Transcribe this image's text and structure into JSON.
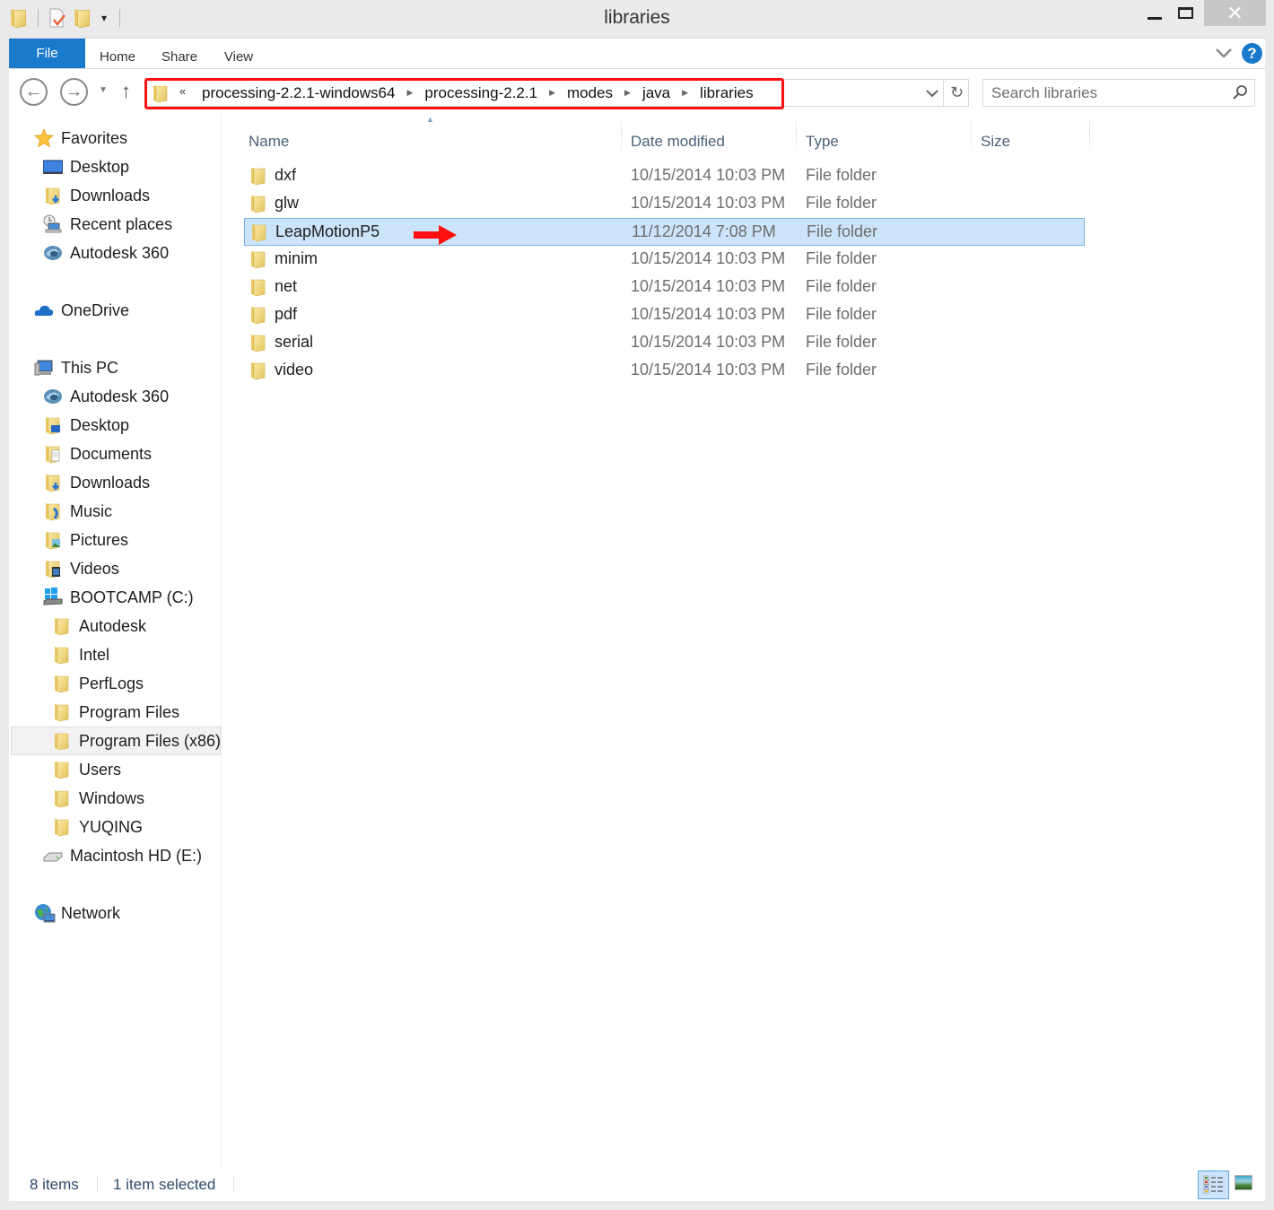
{
  "window": {
    "title": "libraries",
    "controls": {
      "minimize": "minimize",
      "maximize": "maximize",
      "close": "✕"
    }
  },
  "quick_access": {
    "icons": [
      "folder-icon",
      "properties-icon",
      "new-folder-icon"
    ],
    "dropdown": "▾"
  },
  "ribbon": {
    "tabs": [
      {
        "label": "File",
        "active": true
      },
      {
        "label": "Home"
      },
      {
        "label": "Share"
      },
      {
        "label": "View"
      }
    ],
    "help": "?"
  },
  "address_bar": {
    "overflow": "«",
    "breadcrumbs": [
      "processing-2.2.1-windows64",
      "processing-2.2.1",
      "modes",
      "java",
      "libraries"
    ],
    "separator": "▶",
    "highlight_color": "#ff1010"
  },
  "search": {
    "placeholder": "Search libraries",
    "value": ""
  },
  "nav_pane": {
    "items": [
      {
        "label": "Favorites",
        "icon": "star-icon",
        "level": 0
      },
      {
        "label": "Desktop",
        "icon": "desktop-icon",
        "level": 1
      },
      {
        "label": "Downloads",
        "icon": "downloads-folder-icon",
        "level": 1
      },
      {
        "label": "Recent places",
        "icon": "recent-places-icon",
        "level": 1
      },
      {
        "label": "Autodesk 360",
        "icon": "autodesk-360-icon",
        "level": 1
      },
      {
        "label": "OneDrive",
        "icon": "onedrive-cloud-icon",
        "level": 0
      },
      {
        "label": "This PC",
        "icon": "computer-icon",
        "level": 0
      },
      {
        "label": "Autodesk 360",
        "icon": "autodesk-360-icon",
        "level": 1
      },
      {
        "label": "Desktop",
        "icon": "desktop-folder-icon",
        "level": 1
      },
      {
        "label": "Documents",
        "icon": "documents-folder-icon",
        "level": 1
      },
      {
        "label": "Downloads",
        "icon": "downloads-folder-icon",
        "level": 1
      },
      {
        "label": "Music",
        "icon": "music-folder-icon",
        "level": 1
      },
      {
        "label": "Pictures",
        "icon": "pictures-folder-icon",
        "level": 1
      },
      {
        "label": "Videos",
        "icon": "videos-folder-icon",
        "level": 1
      },
      {
        "label": "BOOTCAMP (C:)",
        "icon": "windows-drive-icon",
        "level": 1
      },
      {
        "label": "Autodesk",
        "icon": "folder-icon",
        "level": 2
      },
      {
        "label": "Intel",
        "icon": "folder-icon",
        "level": 2
      },
      {
        "label": "PerfLogs",
        "icon": "folder-icon",
        "level": 2
      },
      {
        "label": "Program Files",
        "icon": "folder-icon",
        "level": 2
      },
      {
        "label": "Program Files (x86)",
        "icon": "folder-icon",
        "level": 2,
        "hovered": true
      },
      {
        "label": "Users",
        "icon": "folder-icon",
        "level": 2
      },
      {
        "label": "Windows",
        "icon": "folder-icon",
        "level": 2
      },
      {
        "label": "YUQING",
        "icon": "folder-icon",
        "level": 2
      },
      {
        "label": "Macintosh HD (E:)",
        "icon": "hard-drive-icon",
        "level": 1
      },
      {
        "label": "Network",
        "icon": "network-icon",
        "level": 0
      }
    ]
  },
  "file_list": {
    "columns": [
      "Name",
      "Date modified",
      "Type",
      "Size"
    ],
    "sorted_by": "Name",
    "rows": [
      {
        "name": "dxf",
        "date": "10/15/2014 10:03 PM",
        "type": "File folder",
        "size": ""
      },
      {
        "name": "glw",
        "date": "10/15/2014 10:03 PM",
        "type": "File folder",
        "size": ""
      },
      {
        "name": "LeapMotionP5",
        "date": "11/12/2014 7:08 PM",
        "type": "File folder",
        "size": "",
        "selected": true
      },
      {
        "name": "minim",
        "date": "10/15/2014 10:03 PM",
        "type": "File folder",
        "size": ""
      },
      {
        "name": "net",
        "date": "10/15/2014 10:03 PM",
        "type": "File folder",
        "size": ""
      },
      {
        "name": "pdf",
        "date": "10/15/2014 10:03 PM",
        "type": "File folder",
        "size": ""
      },
      {
        "name": "serial",
        "date": "10/15/2014 10:03 PM",
        "type": "File folder",
        "size": ""
      },
      {
        "name": "video",
        "date": "10/15/2014 10:03 PM",
        "type": "File folder",
        "size": ""
      }
    ],
    "annotation": {
      "type": "arrow",
      "points_to": "LeapMotionP5",
      "color": "#ff1010"
    }
  },
  "status_bar": {
    "item_count": "8 items",
    "selection": "1 item selected",
    "views": [
      "details-view",
      "large-icons-view"
    ],
    "active_view": "details-view"
  }
}
